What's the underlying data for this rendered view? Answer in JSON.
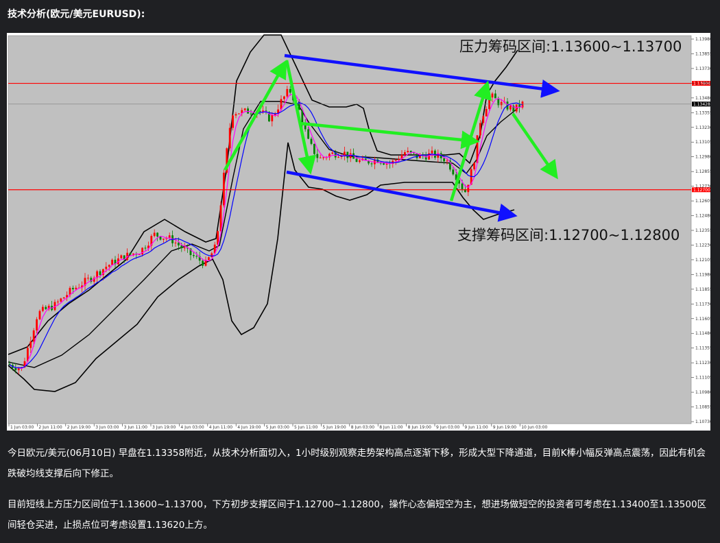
{
  "heading": "技术分析(欧元/美元EURUSD):",
  "chart": {
    "annotations": {
      "resistance": "压力筹码区间:1.13600~1.13700",
      "support": "支撑筹码区间:1.12700~1.12800"
    },
    "price_ticks": [
      "1.13980",
      "1.13855",
      "1.13730",
      "1.13604",
      "1.13480",
      "1.13355",
      "1.13230",
      "1.13105",
      "1.12980",
      "1.12855",
      "1.12730",
      "1.12605",
      "1.12480",
      "1.12355",
      "1.12230",
      "1.12105",
      "1.11980",
      "1.11855",
      "1.11730",
      "1.11605",
      "1.11480",
      "1.11355",
      "1.11230",
      "1.11105",
      "1.10980",
      "1.10855",
      "1.10730"
    ],
    "time_ticks": [
      "1 Jun 03:00",
      "2 Jun 11:00",
      "2 Jun 19:00",
      "3 Jun 03:00",
      "3 Jun 11:00",
      "3 Jun 19:00",
      "4 Jun 03:00",
      "4 Jun 11:00",
      "4 Jun 19:00",
      "5 Jun 03:00",
      "5 Jun 11:00",
      "5 Jun 19:00",
      "8 Jun 03:00",
      "8 Jun 11:00",
      "8 Jun 19:00",
      "9 Jun 03:00",
      "9 Jun 11:00",
      "9 Jun 19:00",
      "10 Jun 03:00"
    ],
    "resistance_level": "1.13604",
    "current_price": "1.13428",
    "support_level": "1.12700",
    "colors": {
      "background": "#c0c0c0",
      "level_line": "#ff0000",
      "channel_arrow": "#1010ff",
      "trend_arrow": "#22ee22",
      "bollinger": "#000000",
      "ma_fast": "#ff00ff",
      "ma_slow": "#0000ff",
      "bull_candle": "#ff0000",
      "bear_candle": "#008000"
    }
  },
  "paragraphs": [
    "今日欧元/美元(06月10日) 早盘在1.13358附近，从技术分析面切入，1小时级别观察走势架构高点逐渐下移，形成大型下降通道，目前K棒小幅反弹高点震荡，因此有机会跌破均线支撑后向下修正。",
    "目前短线上方压力区间位于1.13600~1.13700，下方初步支撑区间于1.12700~1.12800，操作心态偏短空为主，想进场做短空的投资者可考虑在1.13400至1.13500区间轻仓买进，止损点位可考虑设置1.13620上方。"
  ]
}
